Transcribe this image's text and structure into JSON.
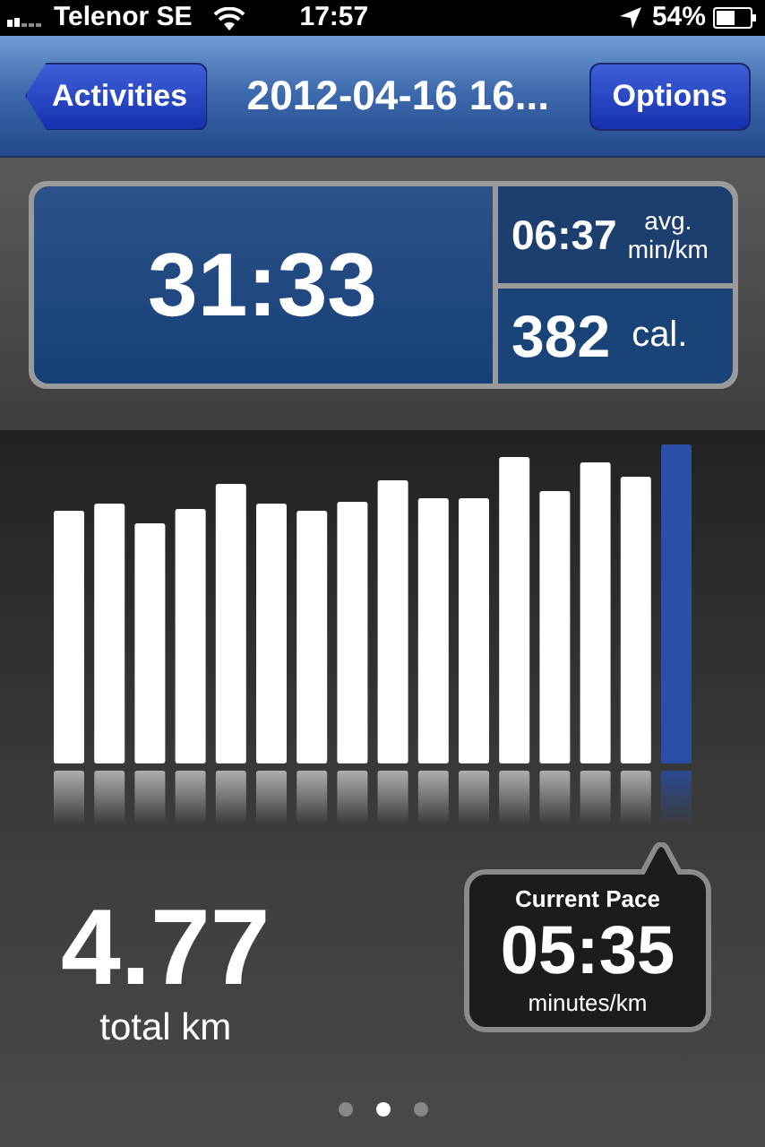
{
  "status_bar": {
    "carrier": "Telenor SE",
    "time": "17:57",
    "battery": "54%"
  },
  "nav_bar": {
    "back_button": "Activities",
    "title": "2012-04-16 16...",
    "right_button": "Options"
  },
  "stats": {
    "duration": "31:33",
    "pace": {
      "value": "06:37",
      "unit_top": "avg.",
      "unit_bottom": "min/km"
    },
    "calories": {
      "value": "382",
      "unit": "cal."
    }
  },
  "distance": {
    "value": "4.77",
    "unit": "total km"
  },
  "current_pace": {
    "label": "Current Pace",
    "value": "05:35",
    "unit": "minutes/km"
  },
  "page_dots": [
    {
      "selected": false
    },
    {
      "selected": true
    },
    {
      "selected": false
    }
  ]
}
